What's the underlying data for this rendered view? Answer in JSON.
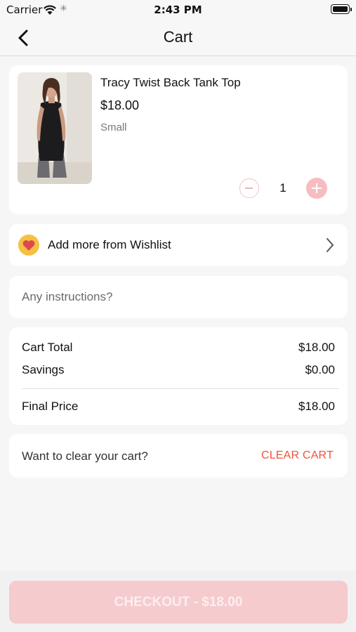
{
  "status_bar": {
    "carrier": "Carrier",
    "time": "2:43 PM",
    "icons": [
      "wifi-icon",
      "activity-icon",
      "battery-icon"
    ]
  },
  "nav": {
    "title": "Cart",
    "back_icon": "chevron-left-icon"
  },
  "cart_item": {
    "name": "Tracy Twist Back Tank Top",
    "price": "$18.00",
    "size": "Small",
    "quantity": "1"
  },
  "wishlist": {
    "label": "Add more from Wishlist",
    "icon": "heart-icon"
  },
  "instructions": {
    "placeholder": "Any instructions?"
  },
  "summary": {
    "cart_total_label": "Cart Total",
    "cart_total_value": "$18.00",
    "savings_label": "Savings",
    "savings_value": "$0.00",
    "final_price_label": "Final Price",
    "final_price_value": "$18.00"
  },
  "clear_cart": {
    "prompt": "Want to clear your cart?",
    "action": "CLEAR CART"
  },
  "checkout": {
    "label": "CHECKOUT - $18.00"
  },
  "colors": {
    "accent": "#f7bcc0",
    "clear_cart": "#f0533a",
    "wishlist_badge": "#f5c142",
    "heart": "#e0484f"
  }
}
